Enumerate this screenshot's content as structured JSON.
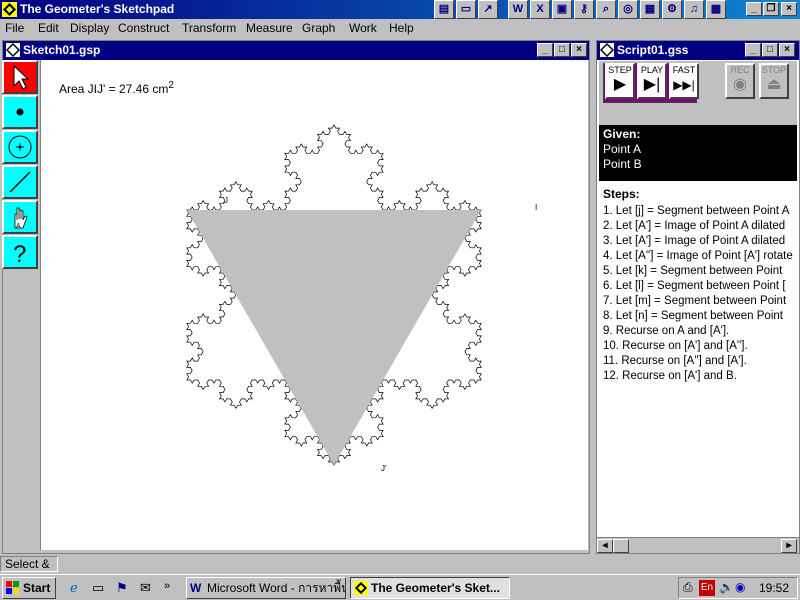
{
  "app": {
    "title": "The Geometer's Sketchpad",
    "menu": [
      "File",
      "Edit",
      "Display",
      "Construct",
      "Transform",
      "Measure",
      "Graph",
      "Work",
      "Help"
    ],
    "toolbar_icons": [
      "notepad-icon",
      "folder-icon",
      "word-icon",
      "excel-icon",
      "presentation-icon",
      "search-icon",
      "internet-icon",
      "network-icon",
      "tools-icon",
      "media-icon",
      "image-icon"
    ],
    "window_controls": [
      "minimize",
      "restore",
      "close"
    ]
  },
  "sketch": {
    "title": "Sketch01.gsp",
    "area_label": "Area JIJ' = 27.46 cm",
    "area_superscript": "2",
    "tools": [
      "arrow-tool",
      "point-tool",
      "compass-tool",
      "segment-tool",
      "text-tool",
      "script-tool"
    ],
    "point_labels": [
      "J",
      "J'",
      "I"
    ]
  },
  "script": {
    "title": "Script01.gss",
    "controls": [
      {
        "label": "STEP",
        "glyph": "▶"
      },
      {
        "label": "PLAY",
        "glyph": "▶|"
      },
      {
        "label": "FAST",
        "glyph": "▶▶|"
      },
      {
        "label": "REC",
        "glyph": "◉"
      },
      {
        "label": "STOP",
        "glyph": "⏏"
      }
    ],
    "given_header": "Given:",
    "given": [
      "Point A",
      "Point B"
    ],
    "steps_header": "Steps:",
    "steps": [
      "1. Let [j] = Segment between Point A",
      "2. Let [A'] = Image of Point A dilated",
      "3. Let [A'] = Image of Point A dilated",
      "4. Let [A''] = Image of Point [A'] rotate",
      "5. Let [k] = Segment between Point",
      "6. Let [l] = Segment between Point [",
      "7. Let [m] = Segment between Point",
      "8. Let [n] = Segment between Point",
      "9. Recurse on A and [A'].",
      "10. Recurse on [A'] and [A''].",
      "11. Recurse on [A''] and [A'].",
      "12. Recurse on [A'] and B."
    ]
  },
  "status": {
    "text": "Select &"
  },
  "taskbar": {
    "start": "Start",
    "tasks": [
      "Microsoft Word - การหาพื้น...",
      "The Geometer's Sket..."
    ],
    "clock": "19:52",
    "lang": "En"
  },
  "colors": {
    "titlebar": "#000080",
    "tool_bg": "#00ffff",
    "triangle_fill": "#c0c0c0",
    "selected_tool": "#ff0000"
  }
}
